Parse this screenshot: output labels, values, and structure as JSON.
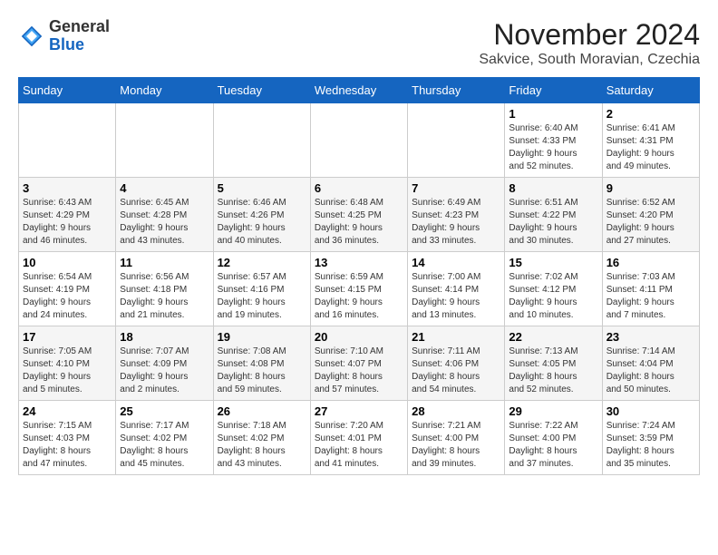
{
  "logo": {
    "general": "General",
    "blue": "Blue"
  },
  "header": {
    "month": "November 2024",
    "location": "Sakvice, South Moravian, Czechia"
  },
  "weekdays": [
    "Sunday",
    "Monday",
    "Tuesday",
    "Wednesday",
    "Thursday",
    "Friday",
    "Saturday"
  ],
  "weeks": [
    [
      {
        "day": "",
        "info": ""
      },
      {
        "day": "",
        "info": ""
      },
      {
        "day": "",
        "info": ""
      },
      {
        "day": "",
        "info": ""
      },
      {
        "day": "",
        "info": ""
      },
      {
        "day": "1",
        "info": "Sunrise: 6:40 AM\nSunset: 4:33 PM\nDaylight: 9 hours\nand 52 minutes."
      },
      {
        "day": "2",
        "info": "Sunrise: 6:41 AM\nSunset: 4:31 PM\nDaylight: 9 hours\nand 49 minutes."
      }
    ],
    [
      {
        "day": "3",
        "info": "Sunrise: 6:43 AM\nSunset: 4:29 PM\nDaylight: 9 hours\nand 46 minutes."
      },
      {
        "day": "4",
        "info": "Sunrise: 6:45 AM\nSunset: 4:28 PM\nDaylight: 9 hours\nand 43 minutes."
      },
      {
        "day": "5",
        "info": "Sunrise: 6:46 AM\nSunset: 4:26 PM\nDaylight: 9 hours\nand 40 minutes."
      },
      {
        "day": "6",
        "info": "Sunrise: 6:48 AM\nSunset: 4:25 PM\nDaylight: 9 hours\nand 36 minutes."
      },
      {
        "day": "7",
        "info": "Sunrise: 6:49 AM\nSunset: 4:23 PM\nDaylight: 9 hours\nand 33 minutes."
      },
      {
        "day": "8",
        "info": "Sunrise: 6:51 AM\nSunset: 4:22 PM\nDaylight: 9 hours\nand 30 minutes."
      },
      {
        "day": "9",
        "info": "Sunrise: 6:52 AM\nSunset: 4:20 PM\nDaylight: 9 hours\nand 27 minutes."
      }
    ],
    [
      {
        "day": "10",
        "info": "Sunrise: 6:54 AM\nSunset: 4:19 PM\nDaylight: 9 hours\nand 24 minutes."
      },
      {
        "day": "11",
        "info": "Sunrise: 6:56 AM\nSunset: 4:18 PM\nDaylight: 9 hours\nand 21 minutes."
      },
      {
        "day": "12",
        "info": "Sunrise: 6:57 AM\nSunset: 4:16 PM\nDaylight: 9 hours\nand 19 minutes."
      },
      {
        "day": "13",
        "info": "Sunrise: 6:59 AM\nSunset: 4:15 PM\nDaylight: 9 hours\nand 16 minutes."
      },
      {
        "day": "14",
        "info": "Sunrise: 7:00 AM\nSunset: 4:14 PM\nDaylight: 9 hours\nand 13 minutes."
      },
      {
        "day": "15",
        "info": "Sunrise: 7:02 AM\nSunset: 4:12 PM\nDaylight: 9 hours\nand 10 minutes."
      },
      {
        "day": "16",
        "info": "Sunrise: 7:03 AM\nSunset: 4:11 PM\nDaylight: 9 hours\nand 7 minutes."
      }
    ],
    [
      {
        "day": "17",
        "info": "Sunrise: 7:05 AM\nSunset: 4:10 PM\nDaylight: 9 hours\nand 5 minutes."
      },
      {
        "day": "18",
        "info": "Sunrise: 7:07 AM\nSunset: 4:09 PM\nDaylight: 9 hours\nand 2 minutes."
      },
      {
        "day": "19",
        "info": "Sunrise: 7:08 AM\nSunset: 4:08 PM\nDaylight: 8 hours\nand 59 minutes."
      },
      {
        "day": "20",
        "info": "Sunrise: 7:10 AM\nSunset: 4:07 PM\nDaylight: 8 hours\nand 57 minutes."
      },
      {
        "day": "21",
        "info": "Sunrise: 7:11 AM\nSunset: 4:06 PM\nDaylight: 8 hours\nand 54 minutes."
      },
      {
        "day": "22",
        "info": "Sunrise: 7:13 AM\nSunset: 4:05 PM\nDaylight: 8 hours\nand 52 minutes."
      },
      {
        "day": "23",
        "info": "Sunrise: 7:14 AM\nSunset: 4:04 PM\nDaylight: 8 hours\nand 50 minutes."
      }
    ],
    [
      {
        "day": "24",
        "info": "Sunrise: 7:15 AM\nSunset: 4:03 PM\nDaylight: 8 hours\nand 47 minutes."
      },
      {
        "day": "25",
        "info": "Sunrise: 7:17 AM\nSunset: 4:02 PM\nDaylight: 8 hours\nand 45 minutes."
      },
      {
        "day": "26",
        "info": "Sunrise: 7:18 AM\nSunset: 4:02 PM\nDaylight: 8 hours\nand 43 minutes."
      },
      {
        "day": "27",
        "info": "Sunrise: 7:20 AM\nSunset: 4:01 PM\nDaylight: 8 hours\nand 41 minutes."
      },
      {
        "day": "28",
        "info": "Sunrise: 7:21 AM\nSunset: 4:00 PM\nDaylight: 8 hours\nand 39 minutes."
      },
      {
        "day": "29",
        "info": "Sunrise: 7:22 AM\nSunset: 4:00 PM\nDaylight: 8 hours\nand 37 minutes."
      },
      {
        "day": "30",
        "info": "Sunrise: 7:24 AM\nSunset: 3:59 PM\nDaylight: 8 hours\nand 35 minutes."
      }
    ]
  ]
}
